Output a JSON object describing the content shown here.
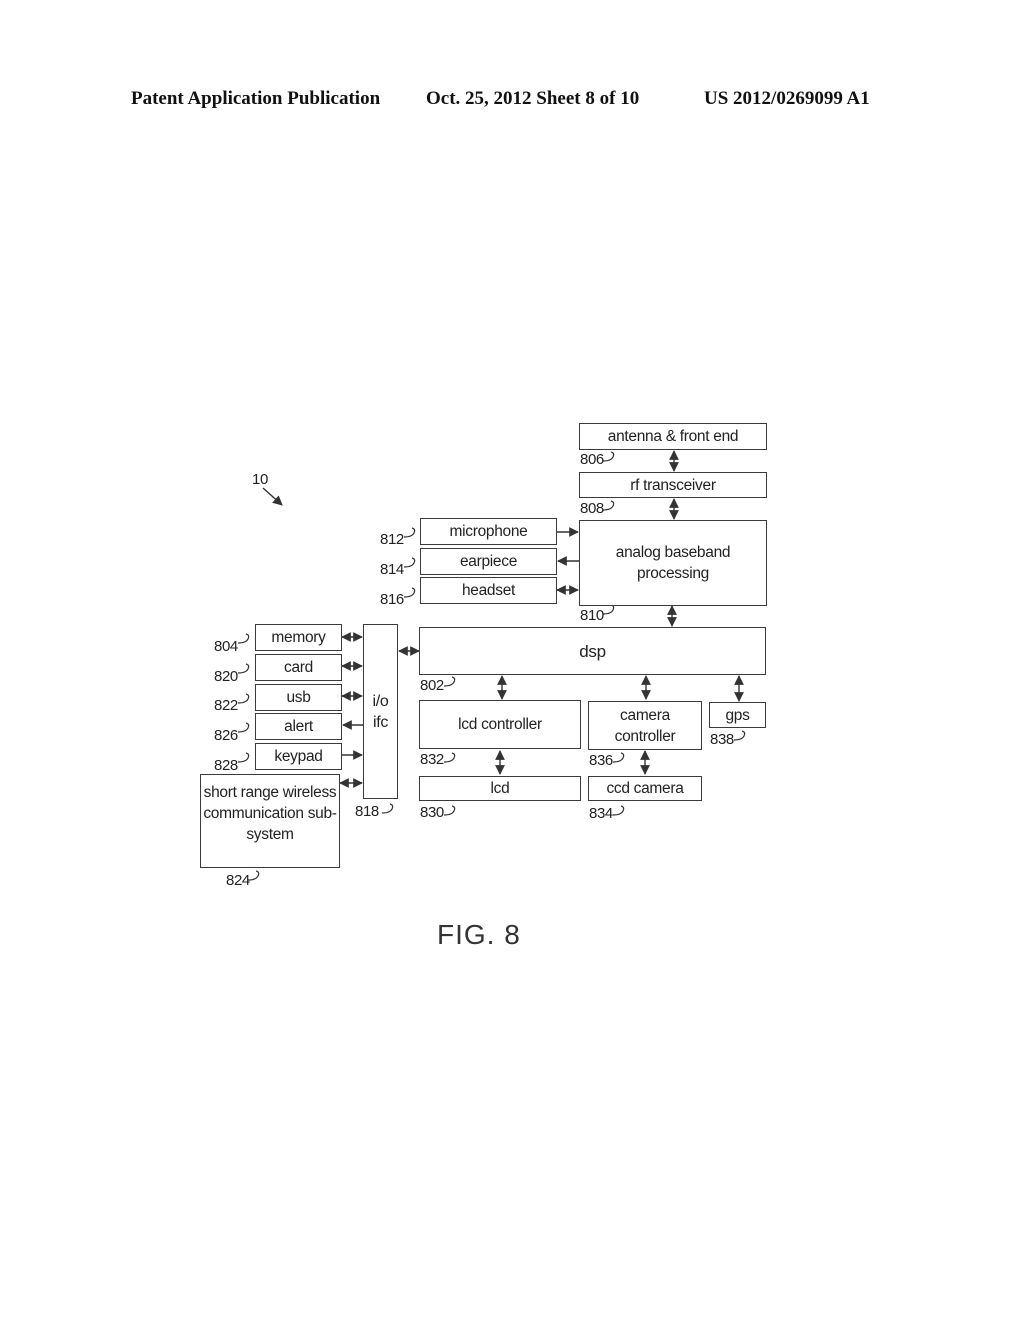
{
  "header": {
    "left": "Patent Application Publication",
    "center": "Oct. 25, 2012   Sheet 8 of 10",
    "right": "US 2012/0269099 A1"
  },
  "figure": {
    "caption": "FIG. 8",
    "device_ref": "10",
    "blocks": {
      "antenna": {
        "label": "antenna & front end",
        "ref": "806"
      },
      "rf": {
        "label": "rf transceiver",
        "ref": "808"
      },
      "analog": {
        "label": "analog baseband processing",
        "ref": "810"
      },
      "microphone": {
        "label": "microphone",
        "ref": "812"
      },
      "earpiece": {
        "label": "earpiece",
        "ref": "814"
      },
      "headset": {
        "label": "headset",
        "ref": "816"
      },
      "dsp": {
        "label": "dsp",
        "ref": "802"
      },
      "io": {
        "label": "i/o ifc",
        "ref": "818"
      },
      "memory": {
        "label": "memory",
        "ref": "804"
      },
      "card": {
        "label": "card",
        "ref": "820"
      },
      "usb": {
        "label": "usb",
        "ref": "822"
      },
      "alert": {
        "label": "alert",
        "ref": "826"
      },
      "keypad": {
        "label": "keypad",
        "ref": "828"
      },
      "shortrange": {
        "label": "short range wireless communication sub-system",
        "ref": "824"
      },
      "lcdctrl": {
        "label": "lcd controller",
        "ref": "832"
      },
      "lcd": {
        "label": "lcd",
        "ref": "830"
      },
      "camctrl": {
        "label": "camera controller",
        "ref": "836"
      },
      "ccd": {
        "label": "ccd camera",
        "ref": "834"
      },
      "gps": {
        "label": "gps",
        "ref": "838"
      }
    }
  }
}
